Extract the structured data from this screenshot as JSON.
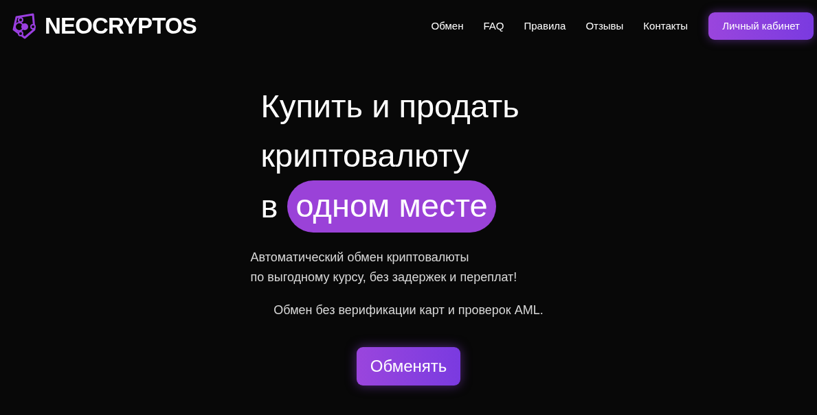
{
  "header": {
    "logo": "NEOCRYPTOS",
    "nav": [
      "Обмен",
      "FAQ",
      "Правила",
      "Отзывы",
      "Контакты"
    ],
    "account_button": "Личный кабинет"
  },
  "hero": {
    "title_lines": [
      "Купить и продать",
      "криптовалюту"
    ],
    "title_prefix": "в",
    "title_highlight": "одном месте",
    "subtitle_lines": [
      "Автоматический обмен криптовалюты",
      "по выгодному курсу, без задержек и переплат!"
    ],
    "note": "Обмен без верификации карт и проверок AML.",
    "button": "Обменять"
  }
}
